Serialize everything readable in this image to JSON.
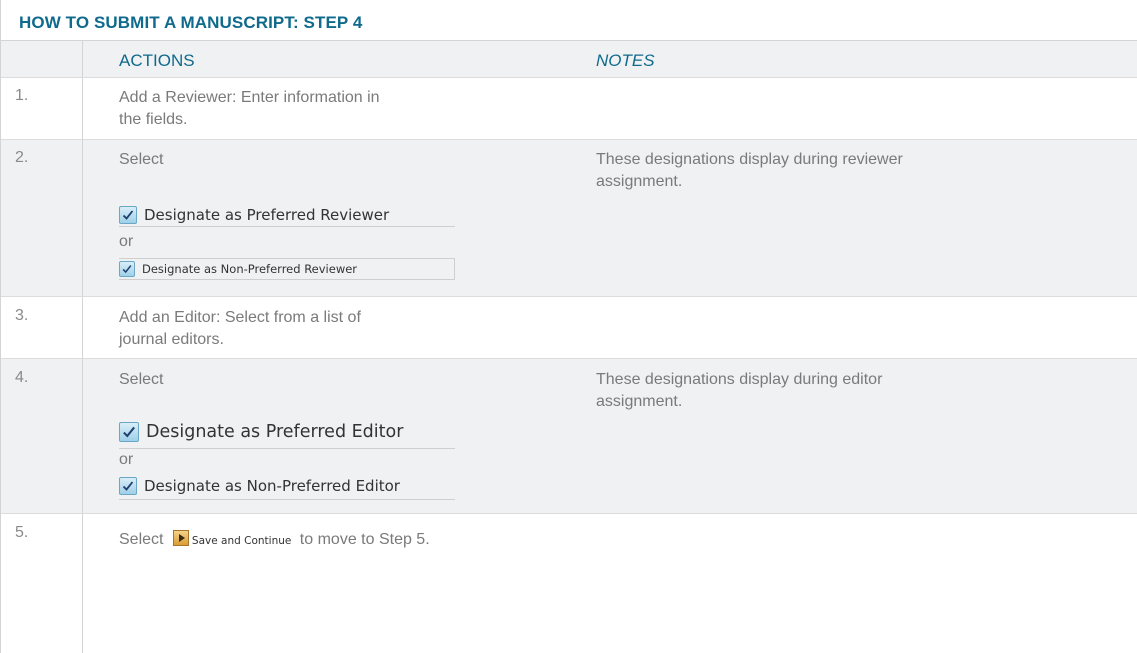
{
  "title": "HOW TO SUBMIT A MANUSCRIPT:  STEP 4",
  "headers": {
    "actions": "ACTIONS",
    "notes": "NOTES"
  },
  "steps": [
    {
      "num": "1.",
      "line1": "Add a Reviewer: Enter information in",
      "line2": "the fields."
    },
    {
      "num": "2.",
      "select": "Select",
      "or": "or",
      "checkbox1": "Designate as Preferred Reviewer",
      "checkbox2": "Designate as Non-Preferred Reviewer",
      "note1": "These designations display during reviewer",
      "note2": "assignment."
    },
    {
      "num": "3.",
      "line1": "Add an Editor: Select from a list of",
      "line2": "journal editors."
    },
    {
      "num": "4.",
      "select": "Select",
      "or": "or",
      "checkbox1": "Designate as Preferred Editor",
      "checkbox2": "Designate as Non-Preferred Editor",
      "note1": "These designations display during editor",
      "note2": "assignment."
    },
    {
      "num": "5.",
      "pre": "Select",
      "button": "Save and Continue",
      "post": "to move to Step 5."
    }
  ],
  "colors": {
    "heading": "#0f6a8c",
    "text": "#7a7a7a",
    "shade": "#eff1f2"
  },
  "icons": {
    "checkbox": "checkmark-icon",
    "button": "play-arrow-icon"
  }
}
